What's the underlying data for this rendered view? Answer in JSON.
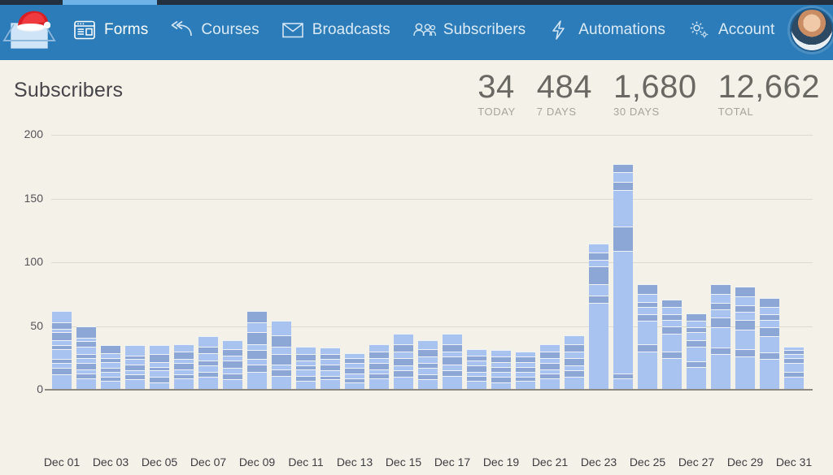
{
  "header": {
    "logo_icon": "envelope-santa-hat-logo",
    "nav": [
      {
        "label": "Forms",
        "icon": "forms-icon",
        "active": true
      },
      {
        "label": "Courses",
        "icon": "courses-icon",
        "active": false
      },
      {
        "label": "Broadcasts",
        "icon": "broadcasts-icon",
        "active": false
      },
      {
        "label": "Subscribers",
        "icon": "subscribers-icon",
        "active": false
      },
      {
        "label": "Automations",
        "icon": "automations-icon",
        "active": false
      },
      {
        "label": "Account",
        "icon": "gear-icon",
        "active": false
      }
    ],
    "avatar_alt": "user-avatar",
    "bar_color": "#2b7cb9",
    "active_tab_color": "#6db3e8"
  },
  "page": {
    "title": "Subscribers",
    "background": "#f4f1e8"
  },
  "stats": [
    {
      "value": "34",
      "label": "TODAY"
    },
    {
      "value": "484",
      "label": "7 DAYS"
    },
    {
      "value": "1,680",
      "label": "30 DAYS"
    },
    {
      "value": "12,662",
      "label": "TOTAL"
    }
  ],
  "chart_data": {
    "type": "bar",
    "title": "Subscribers",
    "xlabel": "",
    "ylabel": "",
    "ylim": [
      0,
      200
    ],
    "yticks": [
      0,
      50,
      100,
      150,
      200
    ],
    "grid": true,
    "legend": false,
    "stacked": true,
    "bar_colors": [
      "#a8c3ef",
      "#8ca6d6"
    ],
    "categories": [
      "Dec 01",
      "Dec 02",
      "Dec 03",
      "Dec 04",
      "Dec 05",
      "Dec 06",
      "Dec 07",
      "Dec 08",
      "Dec 09",
      "Dec 10",
      "Dec 11",
      "Dec 12",
      "Dec 13",
      "Dec 14",
      "Dec 15",
      "Dec 16",
      "Dec 17",
      "Dec 18",
      "Dec 19",
      "Dec 20",
      "Dec 21",
      "Dec 22",
      "Dec 23",
      "Dec 24",
      "Dec 25",
      "Dec 26",
      "Dec 27",
      "Dec 28",
      "Dec 29",
      "Dec 30",
      "Dec 31"
    ],
    "tick_labels": [
      "Dec 01",
      "Dec 03",
      "Dec 05",
      "Dec 07",
      "Dec 09",
      "Dec 11",
      "Dec 13",
      "Dec 15",
      "Dec 17",
      "Dec 19",
      "Dec 21",
      "Dec 23",
      "Dec 25",
      "Dec 27",
      "Dec 29",
      "Dec 31"
    ],
    "values": [
      62,
      50,
      35,
      35,
      35,
      36,
      42,
      39,
      62,
      54,
      34,
      33,
      29,
      36,
      44,
      39,
      44,
      32,
      31,
      30,
      36,
      43,
      115,
      177,
      83,
      71,
      60,
      83,
      81,
      72,
      34
    ],
    "segments": [
      [
        12,
        5,
        4,
        3,
        8,
        3,
        4,
        6,
        3,
        5,
        9
      ],
      [
        9,
        4,
        3,
        5,
        4,
        3,
        6,
        4,
        3,
        9
      ],
      [
        7,
        3,
        4,
        3,
        5,
        3,
        4,
        6
      ],
      [
        8,
        4,
        3,
        5,
        4,
        3,
        8
      ],
      [
        6,
        4,
        5,
        3,
        4,
        6,
        7
      ],
      [
        9,
        3,
        4,
        5,
        3,
        6,
        6
      ],
      [
        10,
        4,
        5,
        4,
        6,
        5,
        8
      ],
      [
        8,
        5,
        4,
        6,
        4,
        5,
        7
      ],
      [
        14,
        6,
        4,
        7,
        5,
        9,
        8,
        9
      ],
      [
        11,
        5,
        4,
        8,
        6,
        9,
        11
      ],
      [
        7,
        4,
        5,
        3,
        4,
        5,
        6
      ],
      [
        8,
        3,
        4,
        5,
        4,
        4,
        5
      ],
      [
        6,
        3,
        4,
        4,
        4,
        4,
        4
      ],
      [
        9,
        4,
        3,
        5,
        4,
        5,
        6
      ],
      [
        10,
        5,
        4,
        6,
        5,
        6,
        8
      ],
      [
        8,
        4,
        5,
        4,
        5,
        6,
        7
      ],
      [
        11,
        4,
        5,
        6,
        4,
        6,
        8
      ],
      [
        7,
        4,
        3,
        5,
        4,
        4,
        5
      ],
      [
        6,
        4,
        4,
        4,
        4,
        4,
        5
      ],
      [
        7,
        3,
        4,
        4,
        4,
        4,
        4
      ],
      [
        9,
        4,
        3,
        5,
        4,
        5,
        6
      ],
      [
        10,
        5,
        4,
        6,
        5,
        6,
        7
      ],
      [
        68,
        6,
        9,
        14,
        5,
        6,
        7
      ],
      [
        9,
        4,
        96,
        19,
        29,
        6,
        8,
        6
      ],
      [
        30,
        6,
        18,
        5,
        6,
        4,
        6,
        8
      ],
      [
        25,
        5,
        14,
        6,
        5,
        4,
        6,
        6
      ],
      [
        18,
        4,
        12,
        5,
        6,
        4,
        5,
        6
      ],
      [
        28,
        5,
        16,
        8,
        6,
        5,
        7,
        8
      ],
      [
        26,
        6,
        15,
        8,
        6,
        5,
        7,
        8
      ],
      [
        24,
        5,
        13,
        7,
        6,
        4,
        6,
        7
      ],
      [
        10,
        4,
        7,
        4,
        3,
        3,
        3
      ]
    ]
  }
}
